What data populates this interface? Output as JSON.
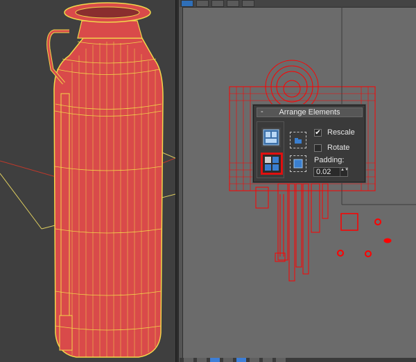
{
  "viewport": {
    "colors": {
      "mesh_fill": "#d94a4a",
      "wire": "#f2d84a",
      "background": "#3f3f3f",
      "uv_wire": "#ff0000"
    }
  },
  "uv_toolbar": {
    "icons": [
      "select-vertex-icon",
      "select-edge-icon",
      "select-poly-icon",
      "move-icon",
      "freeform-icon"
    ]
  },
  "arrange_panel": {
    "toggle": "-",
    "title": "Arrange Elements",
    "rescale": {
      "label": "Rescale",
      "checked": true,
      "mark": "✔"
    },
    "rotate": {
      "label": "Rotate",
      "checked": false,
      "mark": ""
    },
    "padding": {
      "label": "Padding:",
      "value": "0.02",
      "arrows": "▲▼"
    }
  },
  "bottom_bar": {
    "icons": [
      "tool-1-icon",
      "tool-2-icon",
      "tool-3-icon",
      "tool-4-icon",
      "tool-5-icon",
      "tool-6-icon",
      "tool-7-icon",
      "tool-8-icon"
    ]
  }
}
